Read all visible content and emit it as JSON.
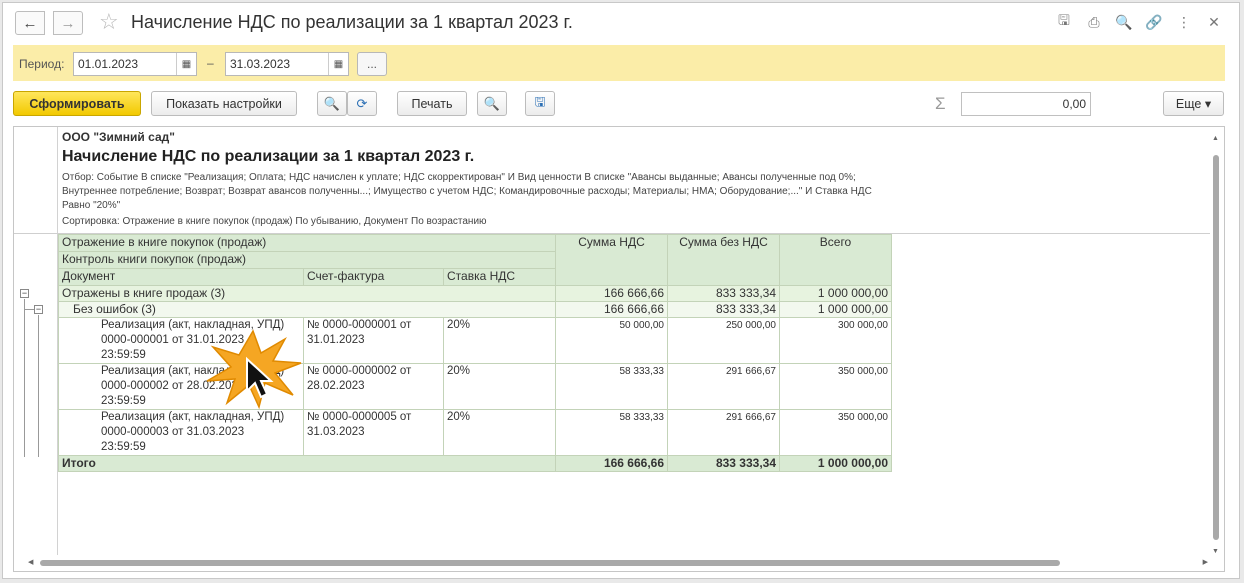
{
  "window": {
    "title": "Начисление НДС по реализации за 1 квартал 2023 г.",
    "nav_back": "←",
    "nav_forward": "→",
    "star": "☆",
    "icons": [
      "save-icon",
      "print-icon",
      "preview-icon",
      "link-icon",
      "more-vertical-icon",
      "close-icon"
    ],
    "icon_glyphs": [
      "🖫",
      "⎙",
      "🔍",
      "🔗",
      "⋮",
      "✕"
    ]
  },
  "period": {
    "label": "Период:",
    "from": "01.01.2023",
    "dash": "–",
    "to": "31.03.2023",
    "dots": "...",
    "cal_glyph": "▦"
  },
  "toolbar": {
    "generate": "Сформировать",
    "show_settings": "Показать настройки",
    "search_glyph": "🔍",
    "search_next_glyph": "⟳",
    "print": "Печать",
    "preview_glyph": "🔍",
    "save_glyph": "🖫",
    "sigma": "Σ",
    "sum_value": "0,00",
    "more": "Еще ▾"
  },
  "report": {
    "org": "ООО \"Зимний сад\"",
    "title": "Начисление НДС по реализации за 1 квартал 2023 г.",
    "filter": "Отбор: Событие В списке \"Реализация; Оплата; НДС начислен к уплате; НДС скорректирован\" И Вид ценности В списке \"Авансы выданные; Авансы полученные под 0%; Внутреннее потребление; Возврат; Возврат авансов полученны...; Имущество с учетом НДС; Командировочные расходы; Материалы; НМА; Оборудование;...\" И Ставка НДС Равно \"20%\"",
    "sort": "Сортировка: Отражение в книге покупок (продаж) По убыванию, Документ По возрастанию",
    "headers": {
      "reflection": "Отражение в книге покупок (продаж)",
      "control": "Контроль книги покупок (продаж)",
      "document": "Документ",
      "invoice": "Счет-фактура",
      "rate": "Ставка НДС",
      "vat_sum": "Сумма НДС",
      "sum_without_vat": "Сумма без НДС",
      "total": "Всего"
    },
    "group": {
      "label": "Отражены в книге продаж (3)",
      "vat": "166 666,66",
      "net": "833 333,34",
      "total": "1 000 000,00"
    },
    "subgroup": {
      "label": "Без ошибок (3)",
      "vat": "166 666,66",
      "net": "833 333,34",
      "total": "1 000 000,00"
    },
    "rows": [
      {
        "doc1": "Реализация (акт, накладная, УПД)",
        "doc2": "0000-000001 от 31.01.2023",
        "doc3": "23:59:59",
        "inv1": "№ 0000-0000001 от",
        "inv2": "31.01.2023",
        "rate": "20%",
        "vat": "50 000,00",
        "net": "250 000,00",
        "total": "300 000,00"
      },
      {
        "doc1": "Реализация (акт, накладная, УПД)",
        "doc2": "0000-000002 от 28.02.2023",
        "doc3": "23:59:59",
        "inv1": "№ 0000-0000002 от",
        "inv2": "28.02.2023",
        "rate": "20%",
        "vat": "58 333,33",
        "net": "291 666,67",
        "total": "350 000,00"
      },
      {
        "doc1": "Реализация (акт, накладная, УПД)",
        "doc2": "0000-000003 от 31.03.2023",
        "doc3": "23:59:59",
        "inv1": "№ 0000-0000005 от",
        "inv2": "31.03.2023",
        "rate": "20%",
        "vat": "58 333,33",
        "net": "291 666,67",
        "total": "350 000,00"
      }
    ],
    "totals": {
      "label": "Итого",
      "vat": "166 666,66",
      "net": "833 333,34",
      "total": "1 000 000,00"
    },
    "tree_minus": "−"
  },
  "colors": {
    "period_bar": "#fbeda8",
    "primary_button": "#f2c900",
    "header_green": "#d9ead3",
    "cursor_burst": "#f5a623"
  }
}
